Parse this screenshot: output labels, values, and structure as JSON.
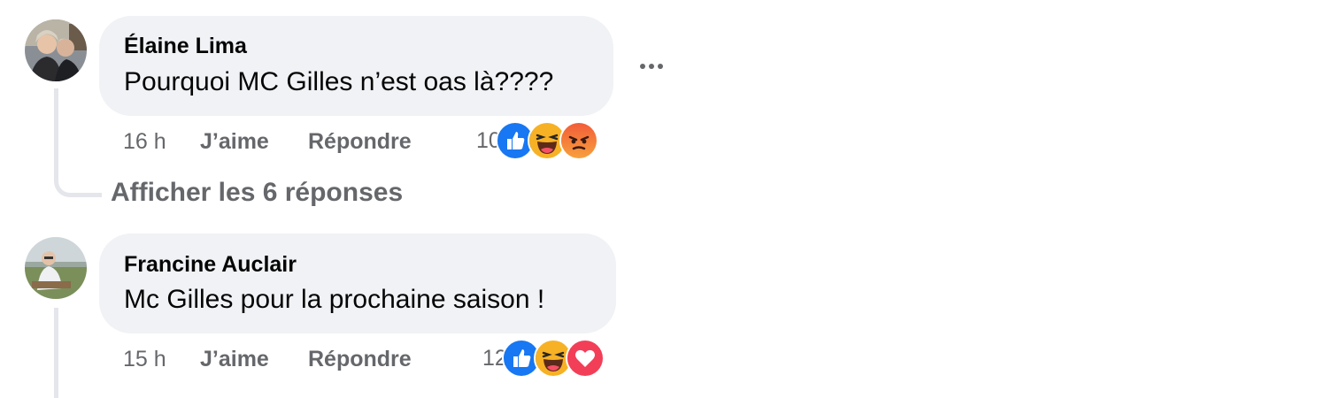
{
  "comments": [
    {
      "author": "Élaine Lima",
      "text": "Pourquoi MC Gilles n’est oas là????",
      "time": "16 h",
      "like_label": "J’aime",
      "reply_label": "Répondre",
      "reaction_count": "10",
      "reactions": [
        "like-icon",
        "haha-icon",
        "angry-icon"
      ]
    },
    {
      "author": "Francine Auclair",
      "text": "Mc Gilles pour la prochaine saison !",
      "time": "15 h",
      "like_label": "J’aime",
      "reply_label": "Répondre",
      "reaction_count": "12",
      "reactions": [
        "like-icon",
        "haha-icon",
        "love-icon"
      ]
    }
  ],
  "replies_link": "Afficher les 6 réponses",
  "colors": {
    "bubble": "#f0f2f5",
    "meta_text": "#65676b",
    "like_blue": "#1877f2",
    "love_red": "#f33e58",
    "haha_yellow": "#f7b125",
    "angry_orange": "#e9710f"
  }
}
